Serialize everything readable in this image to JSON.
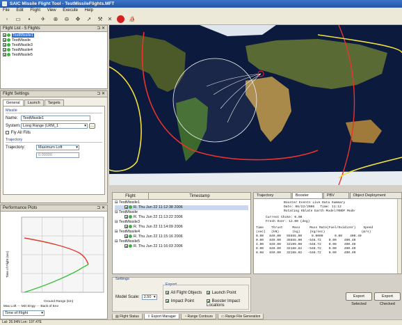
{
  "window": {
    "title": "SAIC Missile Flight Tool - TestMissileFlights.MFT"
  },
  "menu": [
    "File",
    "Edit",
    "Flight",
    "View",
    "Execute",
    "Help"
  ],
  "flight_list": {
    "title": "Flight List - 5 Flights",
    "items": [
      "TestMissile1",
      "TestMissile",
      "TestMissile3",
      "TestMissile4",
      "TestMissile5"
    ]
  },
  "flight_settings": {
    "title": "Flight Settings",
    "tabs": [
      "General",
      "Launch",
      "Targets"
    ],
    "missile_group": "Missile",
    "name_label": "Name:",
    "name_value": "TestMissile1",
    "system_label": "System:",
    "system_value": "Long Range (LRM_1",
    "fly_all_label": "Fly All Fills",
    "trajectory_group": "Trajectory",
    "trajectory_label": "Trajectory:",
    "trajectory_value": "Maximum Loft",
    "trajectory_number": "0.00000"
  },
  "performance_plots": {
    "title": "Performance Plots",
    "ylabel": "Time of Flight (sec)",
    "xlabel": "Ground Range (km)",
    "legend": [
      "Max Loft",
      "Min Engy",
      "Back of Env"
    ],
    "selector_value": "Time of Flight",
    "colors": {
      "max_loft": "#e03a2a",
      "back_of_env": "#3fbf3f"
    }
  },
  "flight_status": {
    "col_flight": "Flight",
    "col_timestamp": "Timestamp",
    "groups": [
      {
        "name": "TestMissile1",
        "row": "R.  Thu Jun 22 11:12:38 2006"
      },
      {
        "name": "TestMissile",
        "row": "R.  Thu Jun 22 11:13:22 2006"
      },
      {
        "name": "TestMissile3",
        "row": "R.  Thu Jun 22 11:14:09 2006"
      },
      {
        "name": "TestMissile4",
        "row": "R.  Thu Jun 22 11:15:16 2006"
      },
      {
        "name": "TestMissile5",
        "row": "R.  Thu Jun 22 11:16:03 2006"
      }
    ]
  },
  "summary_tabs": [
    "Trajectory Summary",
    "Booster Events",
    "PBV Events",
    "Object Deployment Summary"
  ],
  "booster_report": {
    "heading": "Booster Events Live Data Summary",
    "date_line": "Date: 06/22/2006   Time: 11:12",
    "earth_line": "Rotating Oblate Earth Model/RNOF Mode",
    "current_choke": "Current Choke: 0.00",
    "fresh_over": "Fresh Over: 12.00 (deg)",
    "header_1": "Time    Thrust     Mass     Mass Rate(Fuel/Oxidizer)    Speed",
    "header_2": "(sec)   (kN)       (kg)     (kg/sec)                   (m/s)",
    "rows": [
      "0.00   849.00   55555.00     0.0000      0.00    400.40",
      "0.00   849.00   35555.00   -548.72    0.00    400.40",
      "4.00   849.00   33199.00   -548.72    0.00    400.40",
      "8.00   849.00   32188.82   -548.72    0.00    400.40",
      "8.08   849.00   32188.02   -548.72    0.00    400.40"
    ]
  },
  "settings": {
    "title": "Settings",
    "model_scale_label": "Model Scale:",
    "model_scale_value": "2.50",
    "export_group": "Export",
    "options": [
      "All Flight Objects",
      "Launch Point",
      "Impact Point",
      "Booster Impact Locations"
    ]
  },
  "buttons": {
    "export_selected": "Export Selected",
    "export_checked": "Export Checked"
  },
  "bottom_tabs": [
    "Flight Status",
    "Export Manager",
    "Range Contours",
    "Range File Generation"
  ],
  "status_text": "Lat: 26.94N Lon: 197.47E"
}
